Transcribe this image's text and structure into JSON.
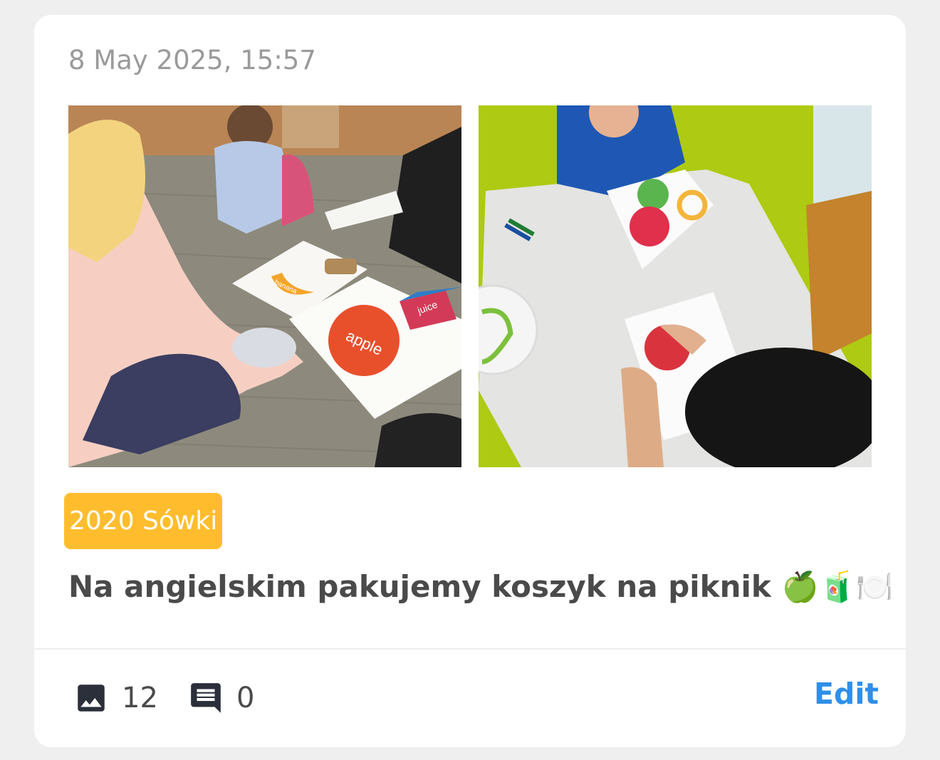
{
  "post": {
    "timestamp": "8 May 2025, 15:57",
    "group_label": "2020 Sówki",
    "text": "Na angielskim pakujemy koszyk na piknik 🍏🧃🍽️",
    "photos": [
      {
        "description_icon": "photo-children-sorting-fruit-cards"
      },
      {
        "description_icon": "photo-children-table-activity"
      }
    ],
    "photo_card_labels": [
      "apple",
      "juice",
      "banana"
    ]
  },
  "footer": {
    "photo_count": "12",
    "comment_count": "0",
    "edit_label": "Edit"
  },
  "colors": {
    "badge": "#ffbd2e",
    "edit_link": "#2f8fe8",
    "icon": "#2a2f3a",
    "text": "#4a4a4a",
    "timestamp": "#9a9a9a"
  }
}
